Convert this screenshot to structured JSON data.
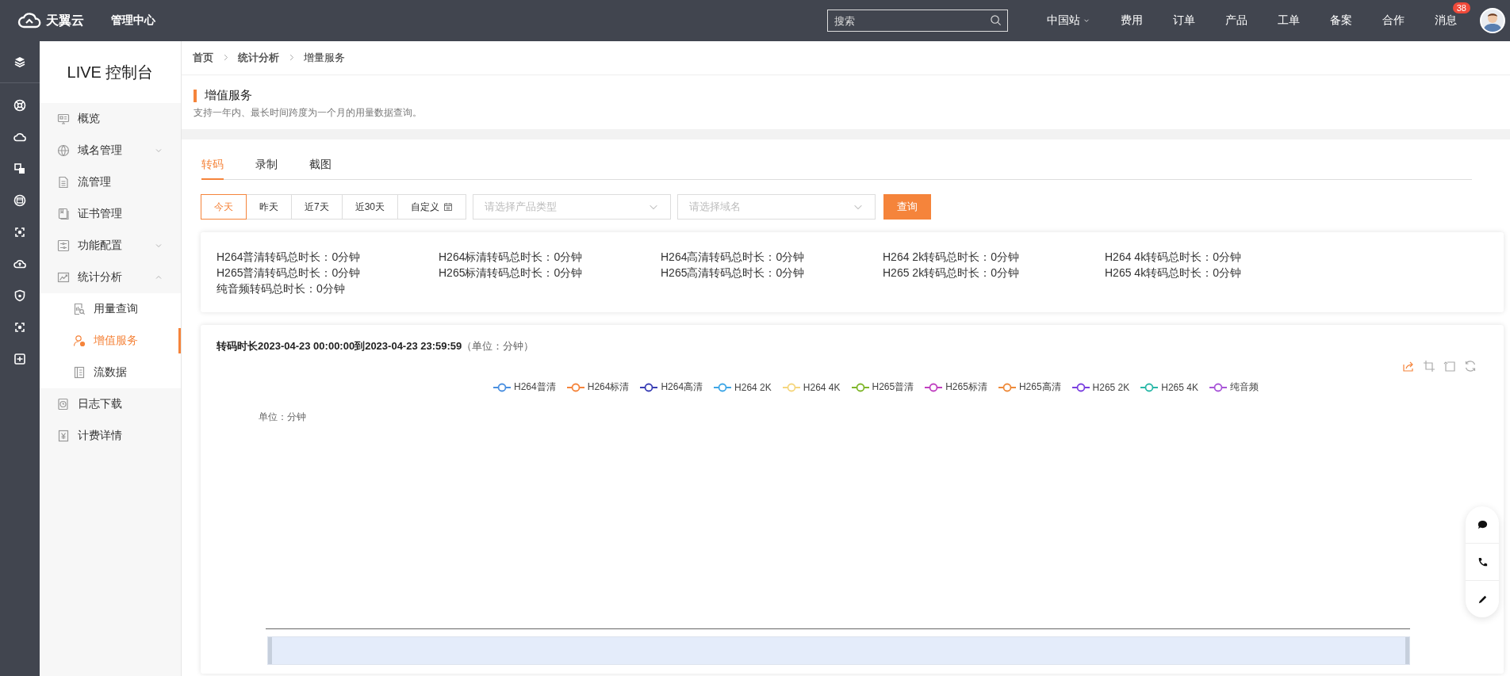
{
  "top_bar": {
    "brand": "天翼云",
    "title": "管理中心",
    "search": {
      "placeholder": "搜索"
    },
    "nav": [
      {
        "label": "中国站",
        "kind": "dropdown"
      },
      {
        "label": "费用",
        "kind": "link"
      },
      {
        "label": "订单",
        "kind": "link"
      },
      {
        "label": "产品",
        "kind": "link"
      },
      {
        "label": "工单",
        "kind": "link"
      },
      {
        "label": "备案",
        "kind": "link"
      },
      {
        "label": "合作",
        "kind": "link"
      },
      {
        "label": "消息",
        "kind": "badge",
        "badge": "38"
      }
    ]
  },
  "sidebar": {
    "title": "LIVE 控制台",
    "items": [
      {
        "label": "概览",
        "selected": false
      },
      {
        "label": "域名管理",
        "selected": false,
        "expanded": false
      },
      {
        "label": "流管理",
        "selected": false
      },
      {
        "label": "证书管理",
        "selected": false
      },
      {
        "label": "功能配置",
        "selected": false,
        "expanded": false
      },
      {
        "label": "统计分析",
        "selected": false,
        "expanded": true,
        "children": [
          {
            "label": "用量查询",
            "selected": false
          },
          {
            "label": "增值服务",
            "selected": true
          },
          {
            "label": "流数据",
            "selected": false
          }
        ]
      },
      {
        "label": "日志下载",
        "selected": false
      },
      {
        "label": "计费详情",
        "selected": false
      }
    ]
  },
  "breadcrumb": [
    "首页",
    "统计分析",
    "增量服务"
  ],
  "header": {
    "title": "增值服务",
    "description": "支持一年内、最长时间跨度为一个月的用量数据查询。"
  },
  "tabs": [
    {
      "label": "转码",
      "selected": true
    },
    {
      "label": "录制",
      "selected": false
    },
    {
      "label": "截图",
      "selected": false
    }
  ],
  "filters": {
    "ranges": [
      {
        "label": "今天",
        "selected": true,
        "kind": "preset"
      },
      {
        "label": "昨天",
        "selected": false,
        "kind": "preset"
      },
      {
        "label": "近7天",
        "selected": false,
        "kind": "preset"
      },
      {
        "label": "近30天",
        "selected": false,
        "kind": "preset"
      },
      {
        "label": "自定义",
        "selected": false,
        "kind": "custom"
      }
    ],
    "selects": [
      {
        "placeholder": "请选择产品类型"
      },
      {
        "placeholder": "请选择域名"
      }
    ],
    "query_button": "查询"
  },
  "stats": [
    "H264普清转码总时长：0分钟",
    "H264标清转码总时长：0分钟",
    "H264高清转码总时长：0分钟",
    "H264 2k转码总时长：0分钟",
    "H264 4k转码总时长：0分钟",
    "H265普清转码总时长：0分钟",
    "H265标清转码总时长：0分钟",
    "H265高清转码总时长：0分钟",
    "H265 2k转码总时长：0分钟",
    "H265 4k转码总时长：0分钟",
    "纯音频转码总时长：0分钟"
  ],
  "chart": {
    "zoom": {
      "level": 1
    },
    "title": "转码时长2023-04-23 00:00:00到2023-04-23 23:59:59",
    "unit_note": "（单位：分钟）",
    "y_unit": "单位：分钟",
    "legend": [
      {
        "name": "H264普清",
        "color": "#4a8fe0"
      },
      {
        "name": "H264标清",
        "color": "#f5843b"
      },
      {
        "name": "H264高清",
        "color": "#3a3fb5"
      },
      {
        "name": "H264 2K",
        "color": "#3ea6e6"
      },
      {
        "name": "H264 4K",
        "color": "#f5d67e"
      },
      {
        "name": "H265普清",
        "color": "#7fb62a"
      },
      {
        "name": "H265标清",
        "color": "#c040c0"
      },
      {
        "name": "H265高清",
        "color": "#ee8a3a"
      },
      {
        "name": "H265 2K",
        "color": "#7a3fe0"
      },
      {
        "name": "H265 4K",
        "color": "#2ab8a8"
      },
      {
        "name": "纯音频",
        "color": "#a855d8"
      }
    ]
  }
}
